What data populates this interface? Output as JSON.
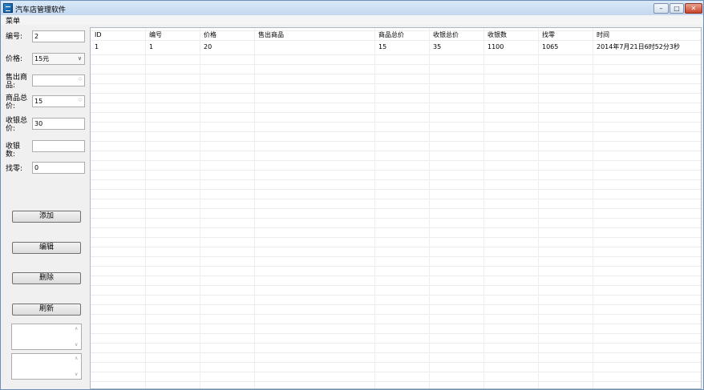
{
  "window": {
    "title": "汽车店管理软件",
    "minimize": "–",
    "maximize": "□",
    "close": "✕"
  },
  "menu": {
    "items": [
      "菜单"
    ]
  },
  "form": {
    "id_label": "编号:",
    "id_value": "2",
    "price_label": "价格:",
    "price_value": "15元",
    "sold_label": "售出商品:",
    "sold_value": "",
    "total_label": "商品总价:",
    "total_value": "15",
    "received_total_label": "收银总价:",
    "received_total_value": "30",
    "received_count_label": "收银数:",
    "received_count_value": "",
    "change_label": "找零:",
    "change_value": "0"
  },
  "buttons": {
    "add": "添加",
    "edit": "编辑",
    "delete": "删除",
    "refresh": "刷新"
  },
  "table": {
    "columns": [
      "ID",
      "编号",
      "价格",
      "售出商品",
      "商品总价",
      "收银总价",
      "收银数",
      "找零",
      "时间"
    ],
    "rows": [
      [
        "1",
        "1",
        "20",
        "",
        "15",
        "35",
        "1100",
        "1065",
        "2014年7月21日6时52分3秒"
      ]
    ]
  }
}
